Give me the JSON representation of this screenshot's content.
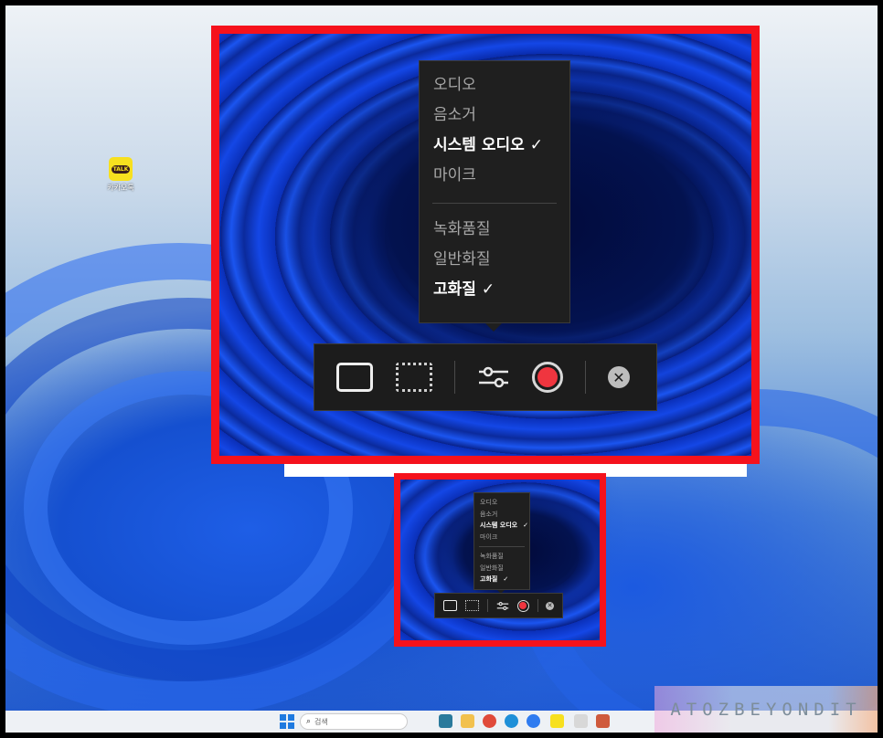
{
  "desktop": {
    "shortcut": {
      "name": "카카오톡",
      "badge": "TALK"
    }
  },
  "recorder_menu": {
    "audio_header": "오디오",
    "audio_options": [
      {
        "label": "음소거",
        "selected": false
      },
      {
        "label": "시스템 오디오",
        "selected": true
      },
      {
        "label": "마이크",
        "selected": false
      }
    ],
    "quality_header": "녹화품질",
    "quality_options": [
      {
        "label": "일반화질",
        "selected": false
      },
      {
        "label": "고화질",
        "selected": true
      }
    ],
    "check_glyph": "✓"
  },
  "toolbar": {
    "buttons": [
      "full-screen-capture",
      "region-capture",
      "settings",
      "record",
      "close"
    ],
    "close_glyph": "✕"
  },
  "taskbar": {
    "search_placeholder": "검색"
  },
  "watermark": "ATOZBEYONDIT",
  "colors": {
    "highlight_border": "#f5121c",
    "record_button": "#f0353f",
    "menu_bg": "#1f1f1f"
  }
}
